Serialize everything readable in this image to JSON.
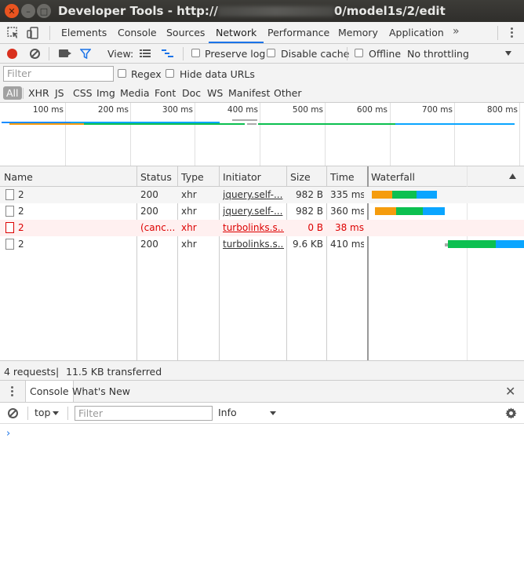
{
  "window": {
    "title_prefix": "Developer Tools - http://",
    "title_suffix": "0/model1s/2/edit"
  },
  "tabs": [
    "Elements",
    "Console",
    "Sources",
    "Network",
    "Performance",
    "Memory",
    "Application"
  ],
  "active_tab": "Network",
  "tab_overflow": "»",
  "toolbar": {
    "view_label": "View:",
    "preserve_log": "Preserve log",
    "disable_cache": "Disable cache",
    "offline": "Offline",
    "throttling": "No throttling"
  },
  "filter": {
    "placeholder": "Filter",
    "regex": "Regex",
    "hide_data_urls": "Hide data URLs"
  },
  "types": [
    "All",
    "XHR",
    "JS",
    "CSS",
    "Img",
    "Media",
    "Font",
    "Doc",
    "WS",
    "Manifest",
    "Other"
  ],
  "overview": {
    "ticks": [
      "100 ms",
      "200 ms",
      "300 ms",
      "400 ms",
      "500 ms",
      "600 ms",
      "700 ms",
      "800 ms"
    ]
  },
  "table": {
    "columns": [
      "Name",
      "Status",
      "Type",
      "Initiator",
      "Size",
      "Time",
      "Waterfall"
    ],
    "rows": [
      {
        "name": "2",
        "status": "200",
        "type": "xhr",
        "initiator": "jquery.self-...",
        "size": "982 B",
        "time": "335 ms",
        "error": false
      },
      {
        "name": "2",
        "status": "200",
        "type": "xhr",
        "initiator": "jquery.self-...",
        "size": "982 B",
        "time": "360 ms",
        "error": false
      },
      {
        "name": "2",
        "status": "(canc...",
        "type": "xhr",
        "initiator": "turbolinks.s...",
        "size": "0 B",
        "time": "38 ms",
        "error": true
      },
      {
        "name": "2",
        "status": "200",
        "type": "xhr",
        "initiator": "turbolinks.s...",
        "size": "9.6 KB",
        "time": "410 ms",
        "error": false
      }
    ]
  },
  "summary": {
    "requests": "4 requests",
    "sep": "|",
    "transferred": "11.5 KB transferred"
  },
  "drawer": {
    "tabs": [
      "Console",
      "What's New"
    ],
    "context": "top",
    "filter_placeholder": "Filter",
    "level": "Info",
    "prompt": "›"
  },
  "colors": {
    "waiting": "#f59c0d",
    "download_start": "#0cc050",
    "download": "#0aa5ff",
    "stalled": "#aaaaaa",
    "accent": "#1a73e8",
    "error": "#dd0000"
  }
}
